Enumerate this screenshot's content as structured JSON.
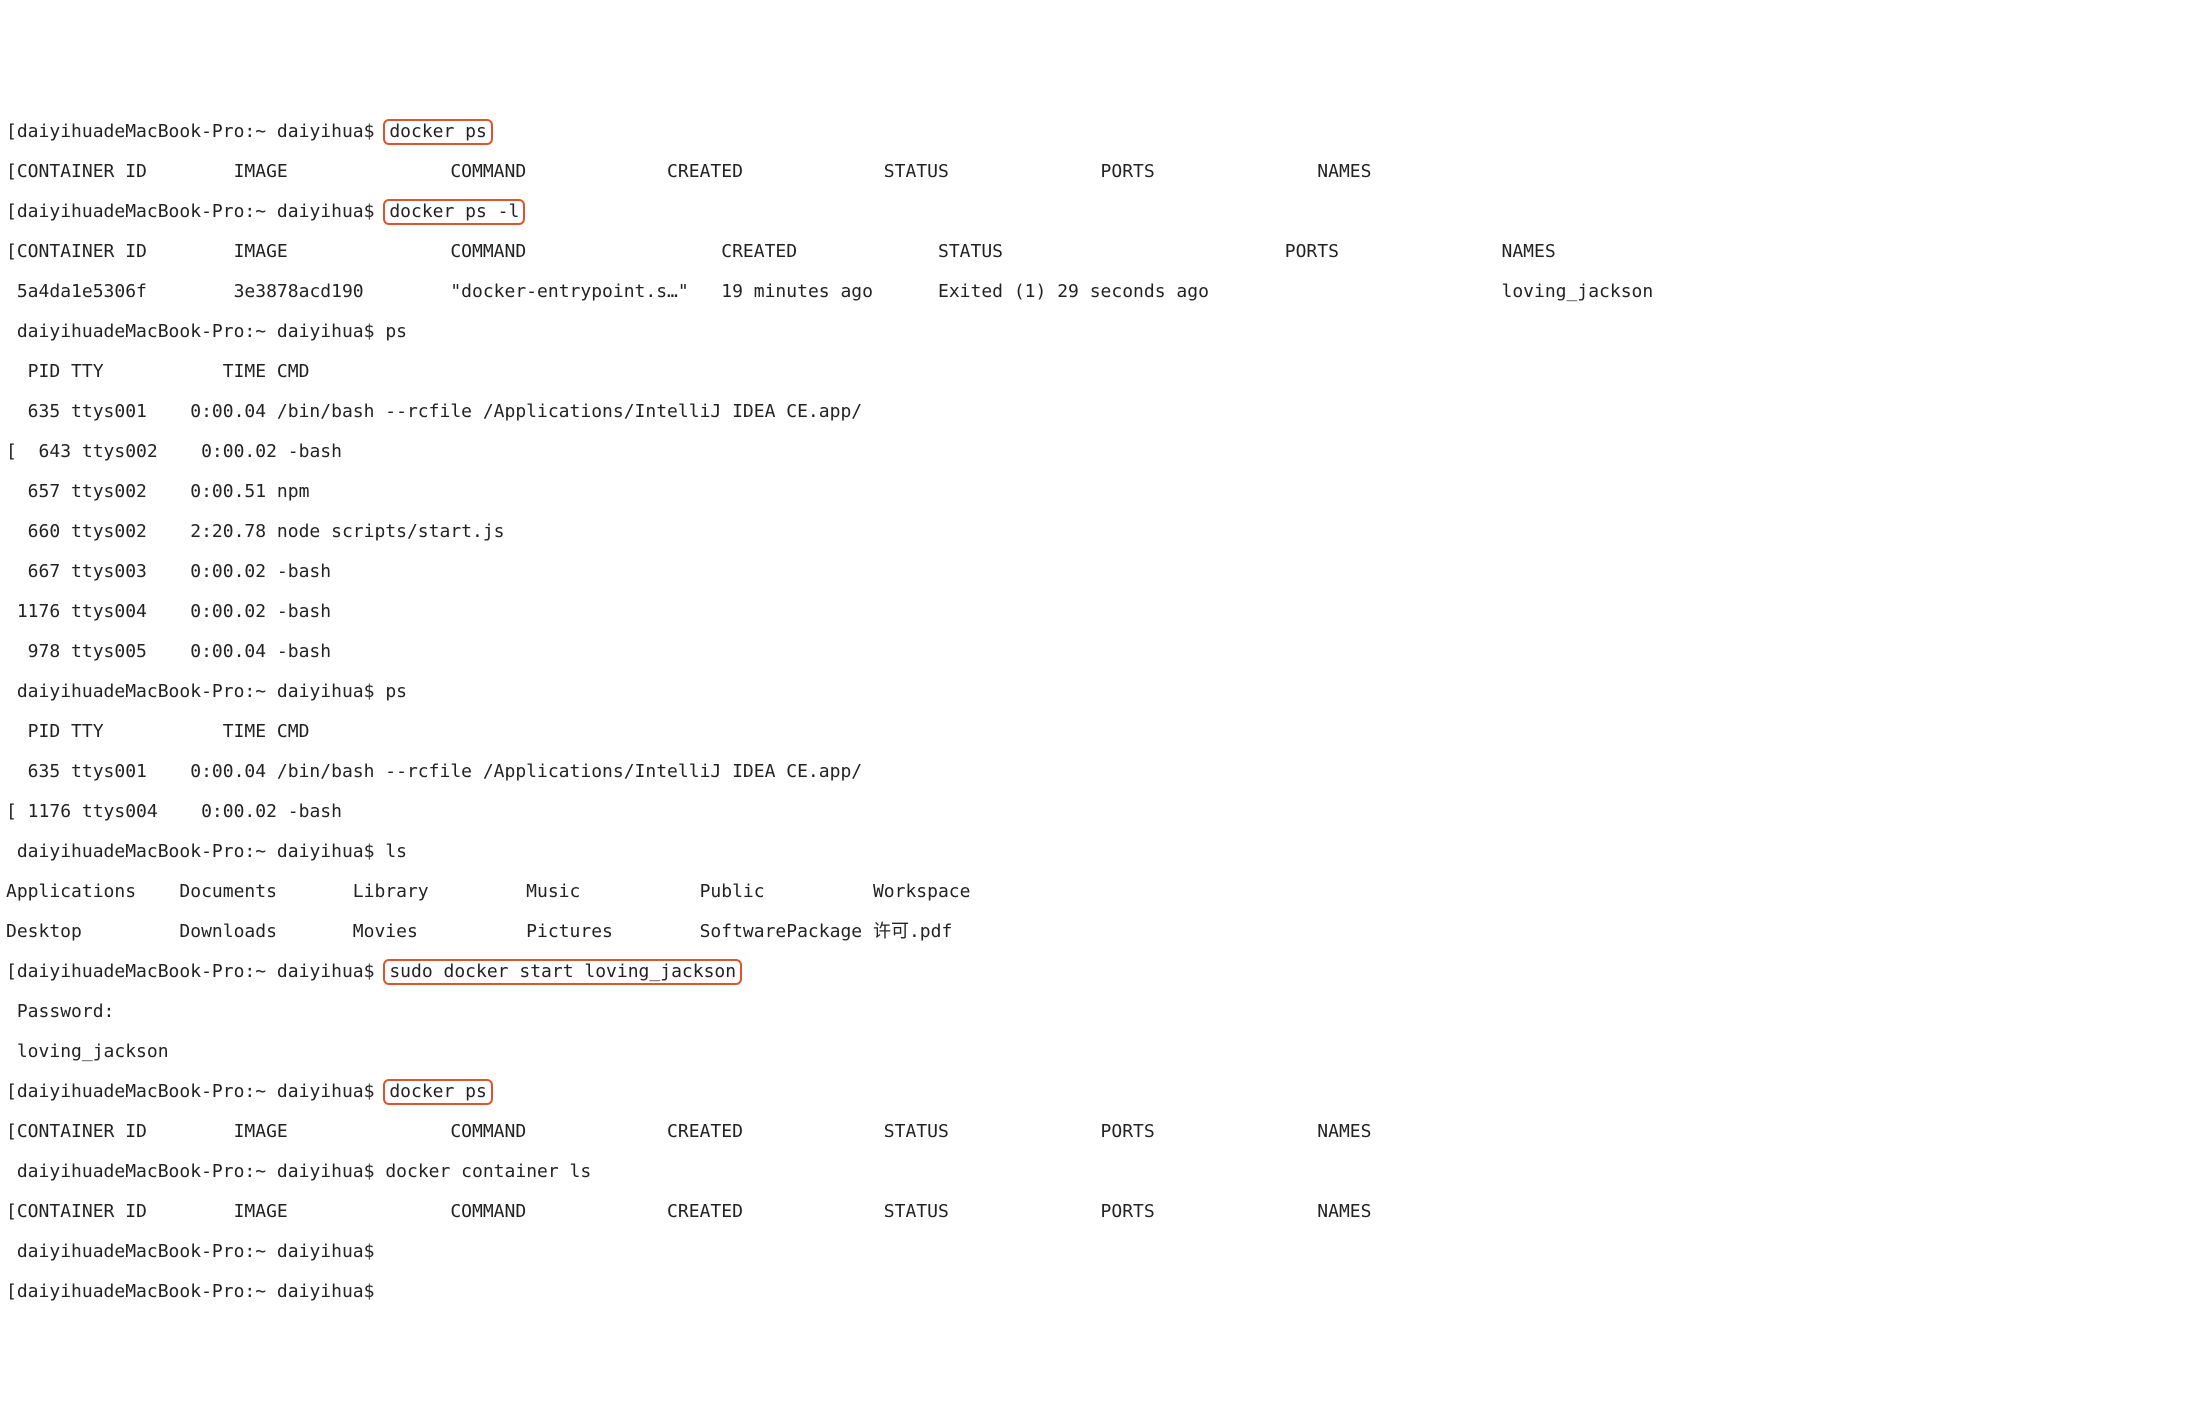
{
  "prompt": "daiyihuadeMacBook-Pro:~ daiyihua$ ",
  "cmd": {
    "docker_ps": "docker ps",
    "docker_ps_l": "docker ps -l",
    "ps": "ps",
    "ls": "ls",
    "sudo_docker_start": "sudo docker start loving_jackson",
    "docker_container_ls": "docker container ls"
  },
  "header1": "CONTAINER ID        IMAGE               COMMAND             CREATED             STATUS              PORTS               NAMES",
  "header2h": "CONTAINER ID        IMAGE               COMMAND                  CREATED             STATUS                          PORTS               NAMES",
  "row2": "5a4da1e5306f        3e3878acd190        \"docker-entrypoint.s…\"   19 minutes ago      Exited (1) 29 seconds ago                           loving_jackson",
  "ps1": {
    "h": "  PID TTY           TIME CMD",
    "r1": "  635 ttys001    0:00.04 /bin/bash --rcfile /Applications/IntelliJ IDEA CE.app/",
    "r2": "  643 ttys002    0:00.02 -bash",
    "r3": "  657 ttys002    0:00.51 npm",
    "r4": "  660 ttys002    2:20.78 node scripts/start.js",
    "r5": "  667 ttys003    0:00.02 -bash",
    "r6": " 1176 ttys004    0:00.02 -bash",
    "r7": "  978 ttys005    0:00.04 -bash"
  },
  "ps2": {
    "h": "  PID TTY           TIME CMD",
    "r1": "  635 ttys001    0:00.04 /bin/bash --rcfile /Applications/IntelliJ IDEA CE.app/",
    "r2": " 1176 ttys004    0:00.02 -bash"
  },
  "ls": {
    "row1": "Applications    Documents       Library         Music           Public          Workspace",
    "row2": "Desktop         Downloads       Movies          Pictures        SoftwarePackage 许可.pdf"
  },
  "pwd": "Password:",
  "started": "loving_jackson",
  "header3": "CONTAINER ID        IMAGE               COMMAND             CREATED             STATUS              PORTS               NAMES",
  "header4": "CONTAINER ID        IMAGE               COMMAND             CREATED             STATUS              PORTS               NAMES"
}
